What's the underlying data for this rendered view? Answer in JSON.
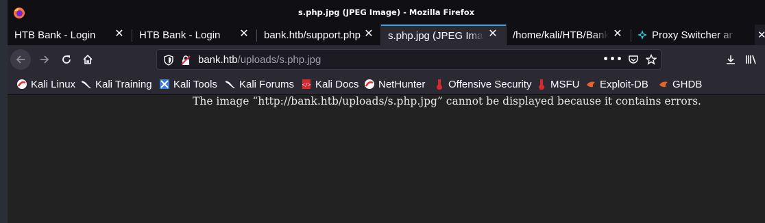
{
  "window": {
    "title": "s.php.jpg (JPEG Image) - Mozilla Firefox"
  },
  "tabs": [
    {
      "label": "HTB Bank - Login",
      "active": false
    },
    {
      "label": "HTB Bank - Login",
      "active": false
    },
    {
      "label": "bank.htb/support.php",
      "active": false
    },
    {
      "label": "s.php.jpg (JPEG Image)",
      "active": true
    },
    {
      "label": "/home/kali/HTB/Bank",
      "active": false
    },
    {
      "label": "Proxy Switcher and",
      "active": false
    }
  ],
  "urlbar": {
    "host": "bank.htb",
    "path": "/uploads/s.php.jpg"
  },
  "bookmarks": [
    {
      "label": "Kali Linux",
      "icon": "kali-linux-icon"
    },
    {
      "label": "Kali Training",
      "icon": "kali-dragon-icon"
    },
    {
      "label": "Kali Tools",
      "icon": "kali-tools-icon"
    },
    {
      "label": "Kali Forums",
      "icon": "kali-dragon-icon"
    },
    {
      "label": "Kali Docs",
      "icon": "kali-docs-icon"
    },
    {
      "label": "NetHunter",
      "icon": "kali-linux-icon"
    },
    {
      "label": "Offensive Security",
      "icon": "offsec-icon"
    },
    {
      "label": "MSFU",
      "icon": "offsec-icon"
    },
    {
      "label": "Exploit-DB",
      "icon": "exploit-db-icon"
    },
    {
      "label": "GHDB",
      "icon": "exploit-db-icon"
    }
  ],
  "content": {
    "error_message": "The image “http://bank.htb/uploads/s.php.jpg” cannot be displayed because it contains errors."
  },
  "colors": {
    "accent": "#3d9ae8",
    "toolbar": "#2b2a33",
    "titlebar": "#0f0f14",
    "content_bg": "#222222"
  }
}
